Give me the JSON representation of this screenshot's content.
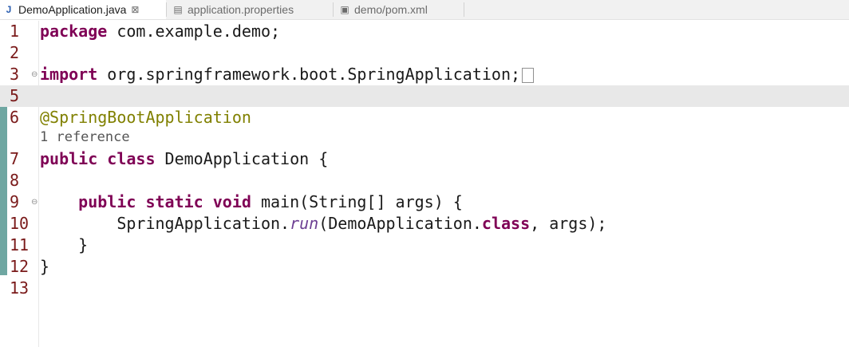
{
  "tabs": [
    {
      "label": "DemoApplication.java",
      "icon": "java-file-icon",
      "icon_glyph": "J",
      "active": true,
      "close": "⊠"
    },
    {
      "label": "application.properties",
      "icon": "properties-file-icon",
      "icon_glyph": "▤",
      "active": false
    },
    {
      "label": "demo/pom.xml",
      "icon": "xml-file-icon",
      "icon_glyph": "▣",
      "active": false
    }
  ],
  "editor": {
    "line_numbers": [
      "1",
      "2",
      "3",
      "5",
      "6",
      "7",
      "8",
      "9",
      "10",
      "11",
      "12",
      "13"
    ],
    "code_lens": "1 reference",
    "lines": {
      "l1": {
        "kw": "package",
        "rest": " com.example.demo;"
      },
      "l3": {
        "kw": "import",
        "rest": " org.springframework.boot.SpringApplication;"
      },
      "l6": {
        "ann": "@SpringBootApplication"
      },
      "l7": {
        "kw": "public class",
        "rest": " DemoApplication {"
      },
      "l9": {
        "indent": "    ",
        "kw": "public static void",
        "rest": " main(String[] args) {"
      },
      "l10": {
        "indent": "        ",
        "pre": "SpringApplication.",
        "mth": "run",
        "mid": "(DemoApplication.",
        "kw": "class",
        "post": ", args);"
      },
      "l11": {
        "text": "    }"
      },
      "l12": {
        "text": "}"
      }
    }
  },
  "colors": {
    "keyword": "#7f0055",
    "annotation": "#808000",
    "method": "#6d3f93",
    "line_number": "#7a1a1a",
    "change_bar": "#6fa7a2"
  }
}
